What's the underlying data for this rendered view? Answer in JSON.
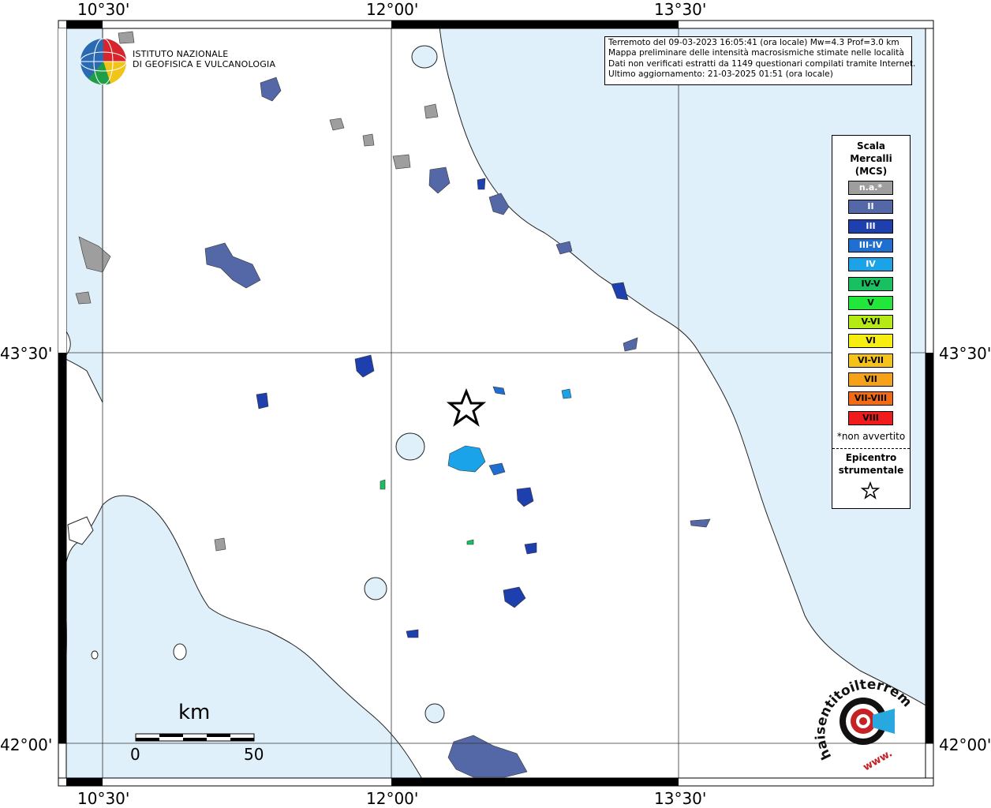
{
  "map": {
    "grid_labels": {
      "lon_top": [
        "10°30'",
        "12°00'",
        "13°30'"
      ],
      "lon_bottom": [
        "10°30'",
        "12°00'",
        "13°30'"
      ],
      "lat_left": [
        "43°30'",
        "42°00'"
      ],
      "lat_right": [
        "43°30'",
        "42°00'"
      ]
    },
    "colors": {
      "sea": "#dff0fa",
      "land": "#ffffff",
      "frame": "#000000"
    },
    "epicenter_icon": "star-outline-icon"
  },
  "logo": {
    "line1": "ISTITUTO NAZIONALE",
    "line2": "DI GEOFISICA E VULCANOLOGIA"
  },
  "info": {
    "line1": "Terremoto del 09-03-2023 16:05:41 (ora locale) Mw=4.3 Prof=3.0 km",
    "line2": "Mappa preliminare delle intensità macrosismiche stimate nelle località",
    "line3": "Dati non verificati estratti da 1149 questionari compilati tramite Internet.",
    "line4": "Ultimo aggiornamento: 21-03-2025 01:51 (ora locale)"
  },
  "legend": {
    "title1": "Scala",
    "title2": "Mercalli",
    "title3": "(MCS)",
    "classes": [
      {
        "label": "n.a.*",
        "color": "#9e9e9e",
        "text_color": "#ffffff"
      },
      {
        "label": "II",
        "color": "#5468a8",
        "text_color": "#ffffff"
      },
      {
        "label": "III",
        "color": "#1e3fae",
        "text_color": "#ffffff"
      },
      {
        "label": "III-IV",
        "color": "#1f6fd1",
        "text_color": "#ffffff"
      },
      {
        "label": "IV",
        "color": "#1aa3e8",
        "text_color": "#ffffff"
      },
      {
        "label": "IV-V",
        "color": "#18c060",
        "text_color": "#000000"
      },
      {
        "label": "V",
        "color": "#22e63a",
        "text_color": "#000000"
      },
      {
        "label": "V-VI",
        "color": "#b6ea14",
        "text_color": "#000000"
      },
      {
        "label": "VI",
        "color": "#f6ee12",
        "text_color": "#000000"
      },
      {
        "label": "VI-VII",
        "color": "#f5c21a",
        "text_color": "#000000"
      },
      {
        "label": "VII",
        "color": "#f5a21a",
        "text_color": "#000000"
      },
      {
        "label": "VII-VIII",
        "color": "#f26a12",
        "text_color": "#000000"
      },
      {
        "label": "VIII",
        "color": "#f01c1c",
        "text_color": "#000000"
      }
    ],
    "na_note": "*non avvertito",
    "epicentre1": "Epicentro",
    "epicentre2": "strumentale"
  },
  "scale_bar": {
    "unit": "km",
    "min": "0",
    "max": "50"
  },
  "hsit": {
    "text": "haisentitoilterremoto.it",
    "www": "www."
  }
}
